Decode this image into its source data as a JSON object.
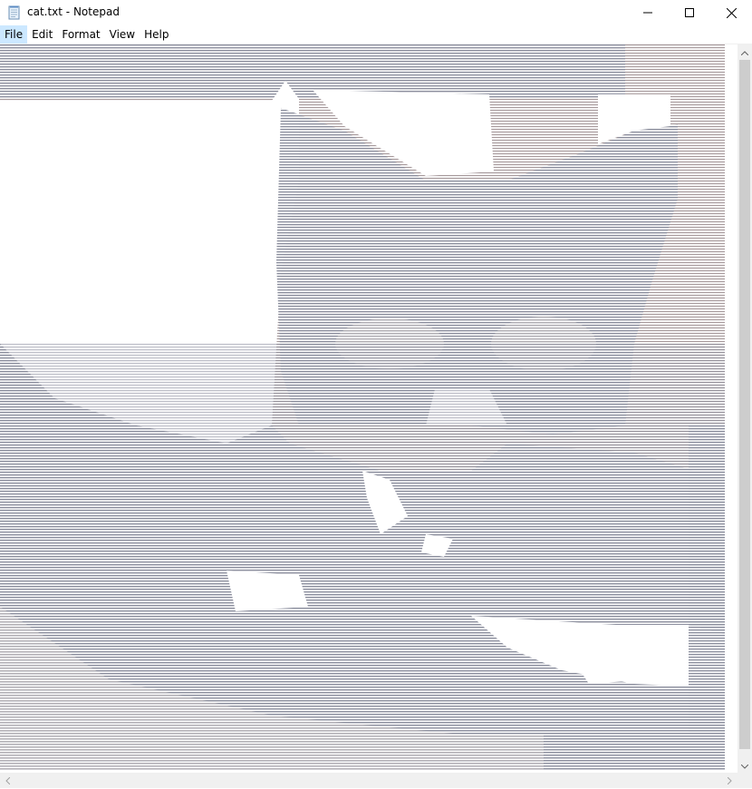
{
  "window": {
    "title": "cat.txt - Notepad",
    "icon": "notepad-icon",
    "controls": [
      "minimize-icon",
      "maximize-icon",
      "close-icon"
    ]
  },
  "menu": {
    "items": [
      {
        "label": "File",
        "active": true
      },
      {
        "label": "Edit"
      },
      {
        "label": "Format"
      },
      {
        "label": "View"
      },
      {
        "label": "Help"
      }
    ]
  },
  "document": {
    "filename": "cat.txt",
    "content_description_icon": "ascii-art-cat",
    "colors": {
      "text": "#8c8f9e",
      "highlight": "#ffffff"
    }
  },
  "colors": {
    "menu_active_bg": "#cce8ff",
    "scrollbar_bg": "#f0f0f0",
    "scrollbar_thumb": "#cdcdcd"
  }
}
